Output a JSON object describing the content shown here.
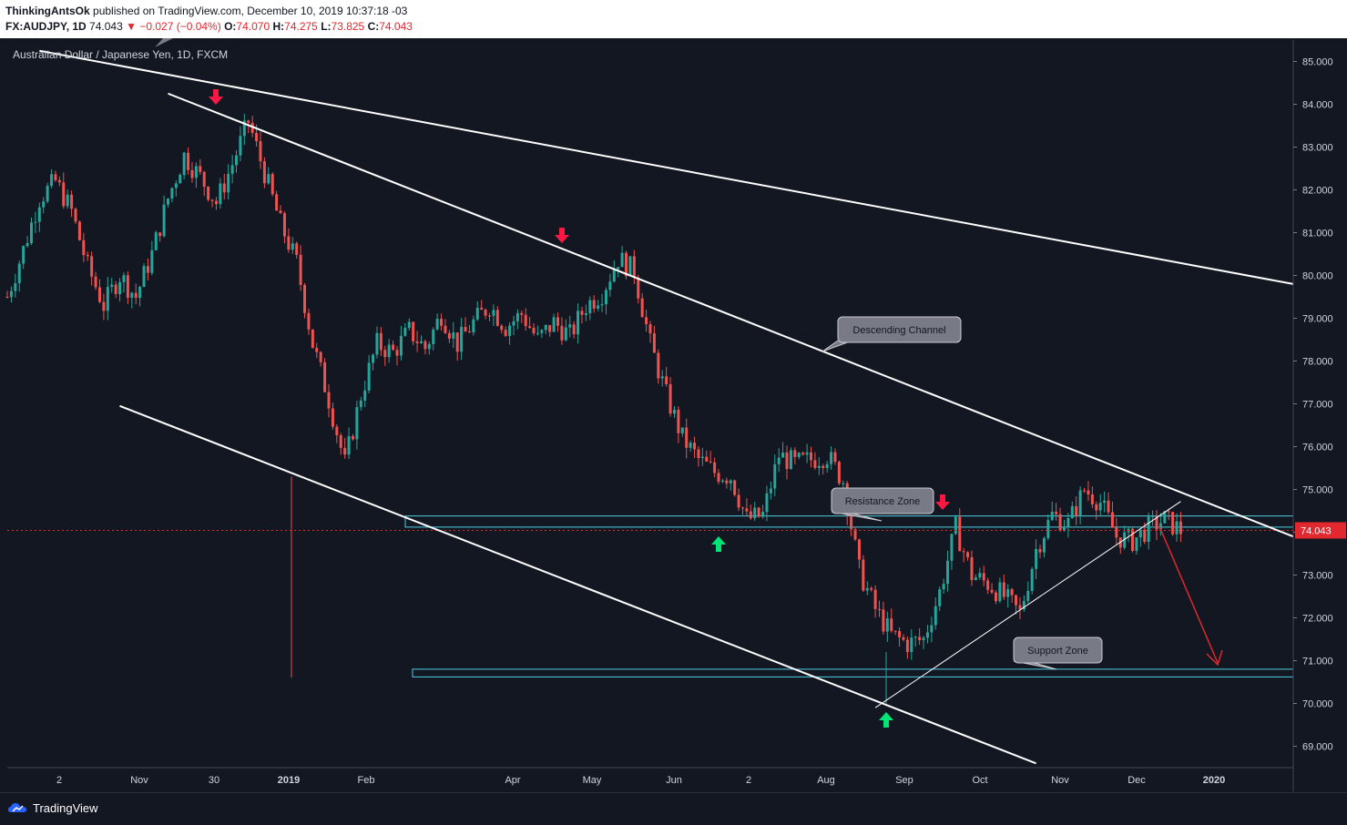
{
  "header": {
    "author": "ThinkingAntsOk",
    "published_text": "published on TradingView.com, December 10, 2019 10:37:18 -03",
    "symbol": "FX:AUDJPY",
    "interval": "1D",
    "last": "74.043",
    "change": "−0.027 (−0.04%)",
    "o_label": "O:",
    "o_value": "74.070",
    "h_label": "H:",
    "h_value": "74.275",
    "l_label": "L:",
    "l_value": "73.825",
    "c_label": "C:",
    "c_value": "74.043"
  },
  "chart_title": "Australian Dollar / Japanese Yen, 1D, FXCM",
  "annotations": {
    "descending_channel": "Descending Channel",
    "resistance_zone": "Resistance Zone",
    "support_zone": "Support Zone"
  },
  "price_tag": "74.043",
  "footer": {
    "brand": "TradingView"
  },
  "colors": {
    "up": "#26a69a",
    "down": "#ef5350",
    "bg": "#131722",
    "zone": "#4dd0e1",
    "arrow_down": "#ff1744",
    "arrow_up": "#00e676",
    "price_line": "#e0282e"
  },
  "chart_data": {
    "type": "candlestick",
    "title": "Australian Dollar / Japanese Yen, 1D, FXCM",
    "y_ticks": [
      85,
      84,
      83,
      82,
      81,
      80,
      79,
      78,
      77,
      76,
      75,
      74,
      73,
      72,
      71,
      70,
      69
    ],
    "y_tick_labels": [
      "85.000",
      "84.000",
      "83.000",
      "82.000",
      "81.000",
      "80.000",
      "79.000",
      "78.000",
      "77.000",
      "76.000",
      "75.000",
      "74.000",
      "73.000",
      "72.000",
      "71.000",
      "70.000",
      "69.000"
    ],
    "x_labels": [
      "2",
      "Nov",
      "30",
      "2019",
      "Feb",
      "Apr",
      "May",
      "Jun",
      "2",
      "Aug",
      "Sep",
      "Oct",
      "Nov",
      "Dec",
      "2020"
    ],
    "close_path": [
      [
        0,
        79.5
      ],
      [
        1,
        80.6
      ],
      [
        2,
        81.8
      ],
      [
        3,
        82.2
      ],
      [
        4,
        81.5
      ],
      [
        5,
        80.2
      ],
      [
        6,
        79.3
      ],
      [
        7,
        80.0
      ],
      [
        8,
        79.5
      ],
      [
        9,
        80.5
      ],
      [
        10,
        81.8
      ],
      [
        11,
        82.8
      ],
      [
        12,
        82.3
      ],
      [
        13,
        81.7
      ],
      [
        14,
        82.6
      ],
      [
        15,
        83.6
      ],
      [
        16,
        82.4
      ],
      [
        17,
        81.2
      ],
      [
        18,
        80.3
      ],
      [
        19,
        78.4
      ],
      [
        20,
        77.1
      ],
      [
        21,
        75.6
      ],
      [
        22,
        77.2
      ],
      [
        23,
        78.4
      ],
      [
        24,
        78.2
      ],
      [
        25,
        78.7
      ],
      [
        26,
        78.3
      ],
      [
        27,
        79.1
      ],
      [
        28,
        78.4
      ],
      [
        29,
        78.9
      ],
      [
        30,
        79.3
      ],
      [
        31,
        78.8
      ],
      [
        32,
        79.1
      ],
      [
        33,
        78.5
      ],
      [
        34,
        78.9
      ],
      [
        35,
        78.6
      ],
      [
        36,
        79.3
      ],
      [
        37,
        79.6
      ],
      [
        38,
        80.4
      ],
      [
        39,
        80.1
      ],
      [
        40,
        78.4
      ],
      [
        41,
        77.2
      ],
      [
        42,
        76.2
      ],
      [
        43,
        75.7
      ],
      [
        44,
        75.4
      ],
      [
        45,
        75.3
      ],
      [
        46,
        74.3
      ],
      [
        47,
        74.4
      ],
      [
        48,
        75.8
      ],
      [
        49,
        75.6
      ],
      [
        50,
        75.7
      ],
      [
        51,
        75.8
      ],
      [
        52,
        75.2
      ],
      [
        53,
        73.1
      ],
      [
        54,
        72.2
      ],
      [
        55,
        71.6
      ],
      [
        56,
        71.4
      ],
      [
        57,
        71.5
      ],
      [
        58,
        72.6
      ],
      [
        59,
        74.1
      ],
      [
        60,
        73.0
      ],
      [
        61,
        72.8
      ],
      [
        62,
        72.5
      ],
      [
        63,
        72.1
      ],
      [
        64,
        73.6
      ],
      [
        65,
        74.4
      ],
      [
        66,
        74.2
      ],
      [
        67,
        75.0
      ],
      [
        68,
        74.7
      ],
      [
        69,
        73.9
      ],
      [
        70,
        73.8
      ],
      [
        71,
        74.1
      ],
      [
        72,
        74.3
      ],
      [
        73,
        74.04
      ]
    ],
    "x_range": [
      0,
      80
    ],
    "y_range": [
      68.5,
      85.5
    ],
    "price_line": 74.043,
    "resistance_zone": [
      74.12,
      74.38
    ],
    "support_zone": [
      70.62,
      70.8
    ],
    "trendlines": [
      {
        "name": "outer-upper",
        "x1": 2,
        "y1": 85.25,
        "x2": 80,
        "y2": 79.8
      },
      {
        "name": "channel-upper",
        "x1": 10,
        "y1": 84.25,
        "x2": 80,
        "y2": 73.9
      },
      {
        "name": "channel-lower",
        "x1": 7,
        "y1": 76.95,
        "x2": 64,
        "y2": 68.6
      },
      {
        "name": "rising",
        "x1": 54,
        "y1": 69.9,
        "x2": 73,
        "y2": 74.72
      }
    ]
  }
}
